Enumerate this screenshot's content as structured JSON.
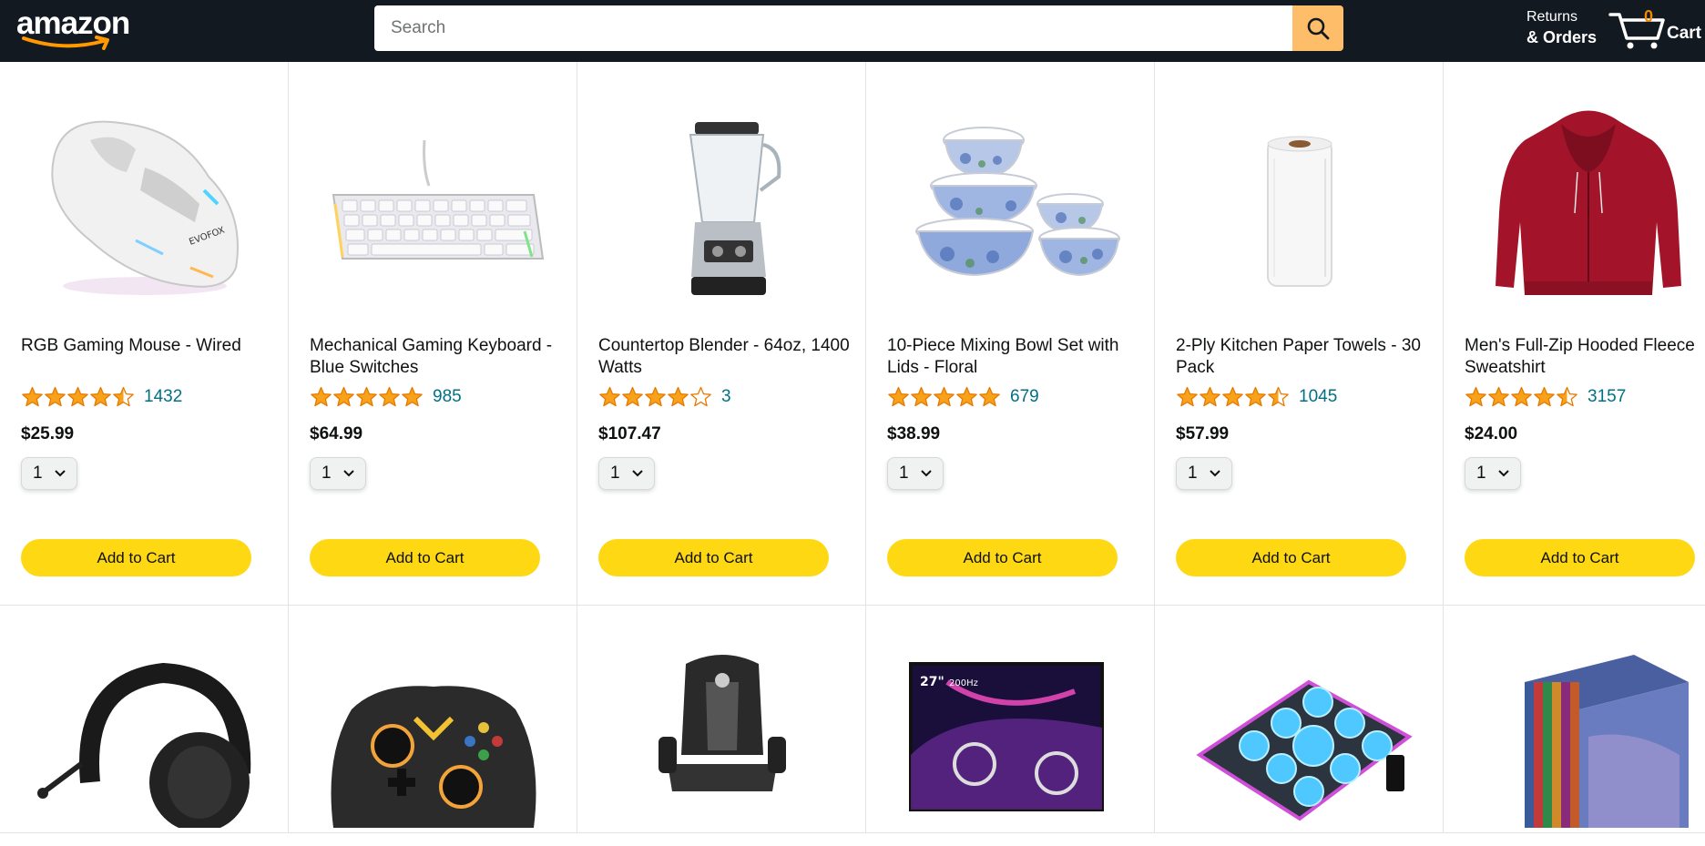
{
  "header": {
    "logo_text": "amazon",
    "search": {
      "placeholder": "Search",
      "value": ""
    },
    "returns": {
      "line1": "Returns",
      "line2": "& Orders"
    },
    "cart": {
      "count": "0",
      "label": "Cart"
    }
  },
  "colors": {
    "header_bg": "#131921",
    "search_btn": "#febd69",
    "add_btn": "#ffd814",
    "star": "#f7a21a",
    "link": "#007185",
    "cart_count": "#f08804"
  },
  "products": [
    {
      "title": "RGB Gaming Mouse - Wired",
      "rating": 4.5,
      "reviews": "1432",
      "price": "$25.99",
      "qty": "1",
      "button": "Add to Cart",
      "image": "gaming-mouse-image"
    },
    {
      "title": "Mechanical Gaming Keyboard - Blue Switches",
      "rating": 5,
      "reviews": "985",
      "price": "$64.99",
      "qty": "1",
      "button": "Add to Cart",
      "image": "keyboard-image"
    },
    {
      "title": "Countertop Blender - 64oz, 1400 Watts",
      "rating": 4,
      "reviews": "3",
      "price": "$107.47",
      "qty": "1",
      "button": "Add to Cart",
      "image": "blender-image"
    },
    {
      "title": "10-Piece Mixing Bowl Set with Lids - Floral",
      "rating": 5,
      "reviews": "679",
      "price": "$38.99",
      "qty": "1",
      "button": "Add to Cart",
      "image": "mixing-bowls-image"
    },
    {
      "title": "2-Ply Kitchen Paper Towels - 30 Pack",
      "rating": 4.5,
      "reviews": "1045",
      "price": "$57.99",
      "qty": "1",
      "button": "Add to Cart",
      "image": "paper-towel-image"
    },
    {
      "title": "Men's Full-Zip Hooded Fleece Sweatshirt",
      "rating": 4.5,
      "reviews": "3157",
      "price": "$24.00",
      "qty": "1",
      "button": "Add to Cart",
      "image": "hoodie-image"
    }
  ],
  "products_row2": [
    {
      "image": "headset-image"
    },
    {
      "image": "game-controller-image"
    },
    {
      "image": "gaming-chair-image"
    },
    {
      "image": "monitor-image",
      "badge1": "27\"",
      "badge2": "200Hz"
    },
    {
      "image": "laptop-cooling-pad-image"
    },
    {
      "image": "book-box-set-image"
    }
  ]
}
